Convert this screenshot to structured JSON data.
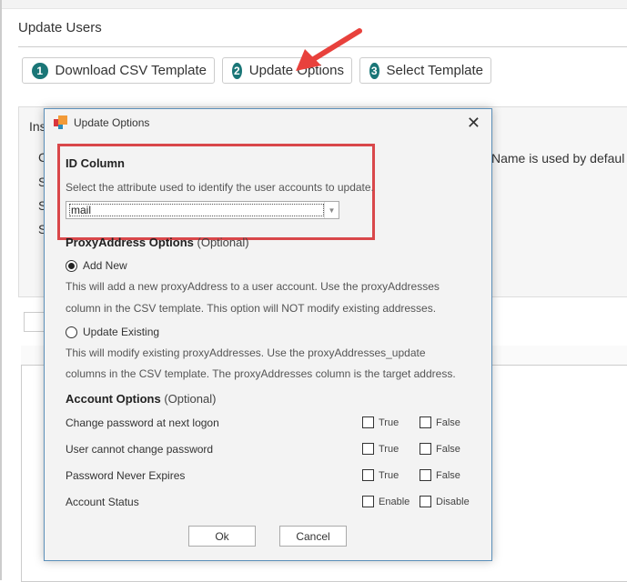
{
  "page": {
    "title": "Update Users",
    "steps": [
      {
        "num": "1",
        "label": "Download CSV Template"
      },
      {
        "num": "2",
        "label": "Update Options"
      },
      {
        "num": "3",
        "label": "Select Template"
      }
    ],
    "background_fragments": {
      "info_heading": "Ins",
      "line1": "C",
      "line2": "S",
      "line3": "S",
      "line4": "S",
      "right_text": "Name is used by defaul"
    },
    "accent_color": "#1a7677",
    "annotation_color": "#d9474a"
  },
  "dialog": {
    "title": "Update Options",
    "id_column": {
      "heading": "ID Column",
      "description": "Select the attribute used to identify the user accounts to update.",
      "selected": "mail"
    },
    "proxy": {
      "heading": "ProxyAddress Options",
      "optional": "(Optional)",
      "options": [
        {
          "label": "Add New",
          "selected": true,
          "description1": "This will add a new proxyAddress to a user account. Use the proxyAddresses",
          "description2": "column in the CSV template. This option will NOT modify existing addresses."
        },
        {
          "label": "Update Existing",
          "selected": false,
          "description1": "This will modify existing proxyAddresses. Use the proxyAddresses_update",
          "description2": "columns in the CSV template. The proxyAddresses column is the target address."
        }
      ]
    },
    "account": {
      "heading": "Account Options",
      "optional": "(Optional)",
      "rows": [
        {
          "label": "Change password at next logon",
          "opt1": "True",
          "opt2": "False"
        },
        {
          "label": "User cannot change password",
          "opt1": "True",
          "opt2": "False"
        },
        {
          "label": "Password Never Expires",
          "opt1": "True",
          "opt2": "False"
        },
        {
          "label": "Account Status",
          "opt1": "Enable",
          "opt2": "Disable"
        }
      ]
    },
    "ok": "Ok",
    "cancel": "Cancel"
  }
}
